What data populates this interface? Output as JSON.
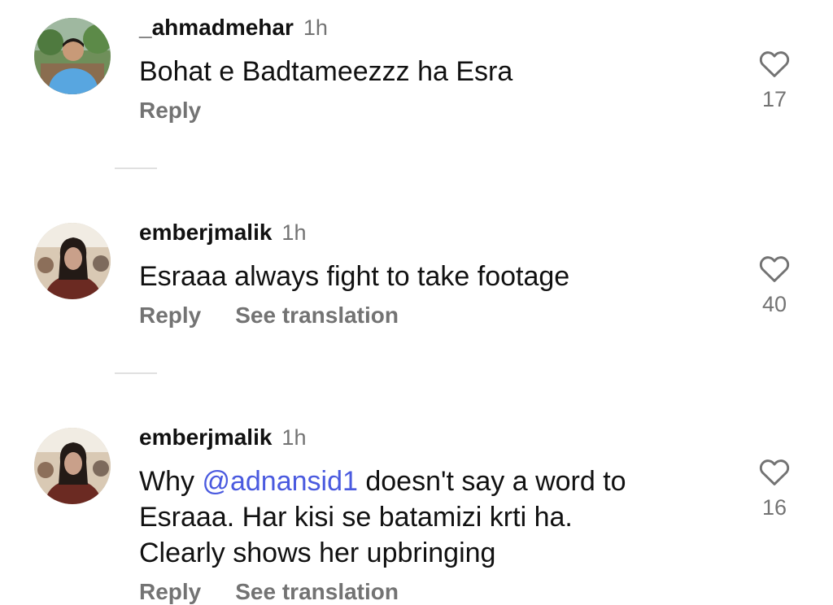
{
  "comments": [
    {
      "username": "_ahmadmehar",
      "time": "1h",
      "text": "Bohat e Badtameezzz ha Esra",
      "reply_label": "Reply",
      "likes": "17",
      "avatar_icon": "user-photo-avatar"
    },
    {
      "username": "emberjmalik",
      "time": "1h",
      "text": "Esraaa always fight to take footage",
      "reply_label": "Reply",
      "translate_label": "See translation",
      "likes": "40",
      "avatar_icon": "user-photo-avatar"
    },
    {
      "username": "emberjmalik",
      "time": "1h",
      "text_before": "Why ",
      "mention": "@adnansid1",
      "text_line1_after": " doesn't say a word to",
      "text_line2": "Esraaa. Har kisi se batamizi krti ha.",
      "text_line3": "Clearly shows her upbringing",
      "reply_label": "Reply",
      "translate_label": "See translation",
      "likes": "16",
      "avatar_icon": "user-photo-avatar"
    }
  ],
  "colors": {
    "text": "#111111",
    "secondary": "#737373",
    "mention": "#4a5adf",
    "divider": "#e0e0e0"
  },
  "icons": {
    "like": "heart-outline-icon"
  }
}
